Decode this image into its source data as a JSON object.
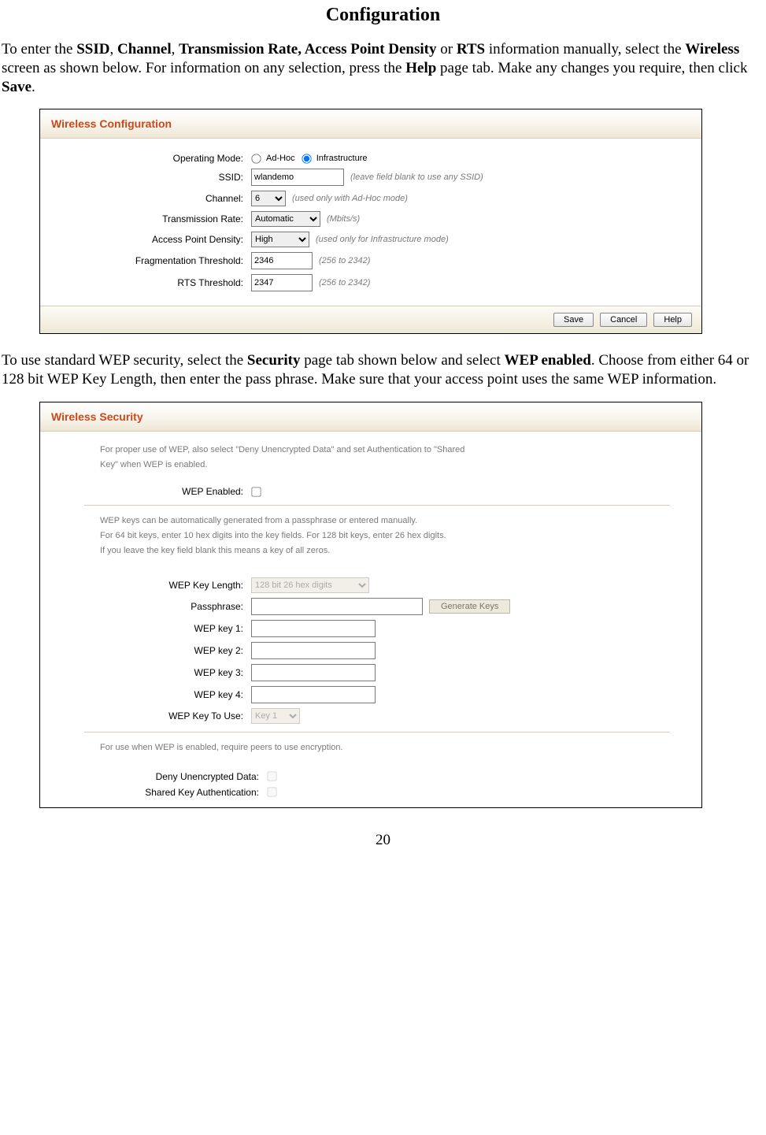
{
  "doc": {
    "title": "Configuration",
    "para1_pre": "To enter the  ",
    "para1_b1": "SSID",
    "para1_sep1": ", ",
    "para1_b2": "Channel",
    "para1_sep2": ", ",
    "para1_b3": "Transmission Rate, Access Point Density",
    "para1_sep3": " or ",
    "para1_b4": "RTS",
    "para1_mid1": " information manually, select the ",
    "para1_b5": "Wireless",
    "para1_mid2": " screen as shown below. For information on any selection, press the ",
    "para1_b6": "Help",
    "para1_mid3": " page tab.  Make any changes you require, then click ",
    "para1_b7": "Save",
    "para1_end": ".",
    "para2_pre": "To use standard WEP security, select the ",
    "para2_b1": "Security",
    "para2_mid1": " page tab shown below and select ",
    "para2_b2": "WEP enabled",
    "para2_end": ".  Choose from either 64 or 128 bit WEP Key Length, then enter the pass phrase.  Make sure that your access point uses the same WEP information.",
    "page_number": "20"
  },
  "panel1": {
    "title": "Wireless Configuration",
    "labels": {
      "op_mode": "Operating Mode:",
      "ssid": "SSID:",
      "channel": "Channel:",
      "tx_rate": "Transmission Rate:",
      "ap_density": "Access Point Density:",
      "frag": "Fragmentation Threshold:",
      "rts": "RTS Threshold:"
    },
    "radios": {
      "adhoc": "Ad-Hoc",
      "infra": "Infrastructure"
    },
    "values": {
      "ssid": "wlandemo",
      "channel": "6",
      "tx_rate": "Automatic",
      "ap_density": "High",
      "frag": "2346",
      "rts": "2347"
    },
    "hints": {
      "ssid": "(leave field blank to use any SSID)",
      "channel": "(used only with Ad-Hoc mode)",
      "tx_rate": "(Mbits/s)",
      "ap_density": "(used only for Infrastructure mode)",
      "frag": "(256 to 2342)",
      "rts": "(256 to 2342)"
    },
    "buttons": {
      "save": "Save",
      "cancel": "Cancel",
      "help": "Help"
    }
  },
  "panel2": {
    "title": "Wireless Security",
    "note1a": "For proper use of WEP, also select \"Deny Unencrypted Data\" and set Authentication to \"Shared",
    "note1b": "Key\" when WEP is enabled.",
    "labels": {
      "wep_enabled": "WEP Enabled:",
      "wep_len": "WEP Key Length:",
      "passphrase": "Passphrase:",
      "key1": "WEP key 1:",
      "key2": "WEP key 2:",
      "key3": "WEP key 3:",
      "key4": "WEP key 4:",
      "key_to_use": "WEP Key To Use:",
      "deny": "Deny Unencrypted Data:",
      "shared": "Shared Key Authentication:"
    },
    "note2a": "WEP keys can be automatically generated from a passphrase or entered manually.",
    "note2b": "For 64 bit keys, enter 10 hex digits into the key fields. For 128 bit keys, enter 26 hex digits.",
    "note2c": "If you leave the key field blank this means a key of all zeros.",
    "values": {
      "wep_len": "128 bit 26 hex digits",
      "key_to_use": "Key 1"
    },
    "buttons": {
      "generate": "Generate Keys"
    },
    "note3": "For use when WEP is enabled, require peers to use encryption."
  }
}
